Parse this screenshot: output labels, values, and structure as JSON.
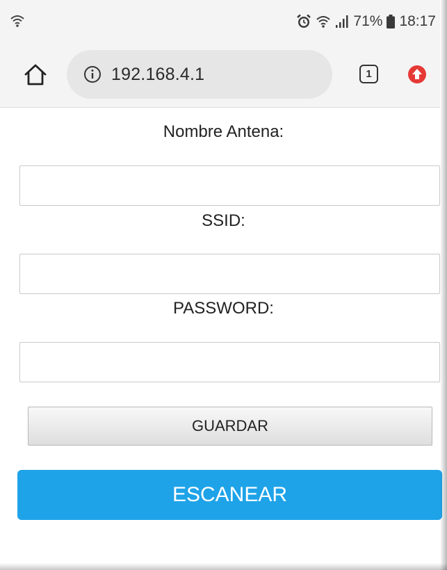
{
  "status_bar": {
    "battery": "71%",
    "time": "18:17",
    "icons": [
      "wifi-icon",
      "alarm-icon",
      "wifi-icon",
      "signal-icon",
      "battery-icon"
    ]
  },
  "browser": {
    "url": "192.168.4.1",
    "tab_count": "1",
    "icons": [
      "home-icon",
      "info-icon",
      "tabs-icon",
      "update-icon"
    ],
    "update_color": "#e53935"
  },
  "form": {
    "antenna_label": "Nombre Antena:",
    "antenna_value": "",
    "ssid_label": "SSID:",
    "ssid_value": "",
    "password_label": "PASSWORD:",
    "password_value": "",
    "save_label": "GUARDAR",
    "scan_label": "ESCANEAR",
    "scan_color": "#1ea3e8"
  }
}
